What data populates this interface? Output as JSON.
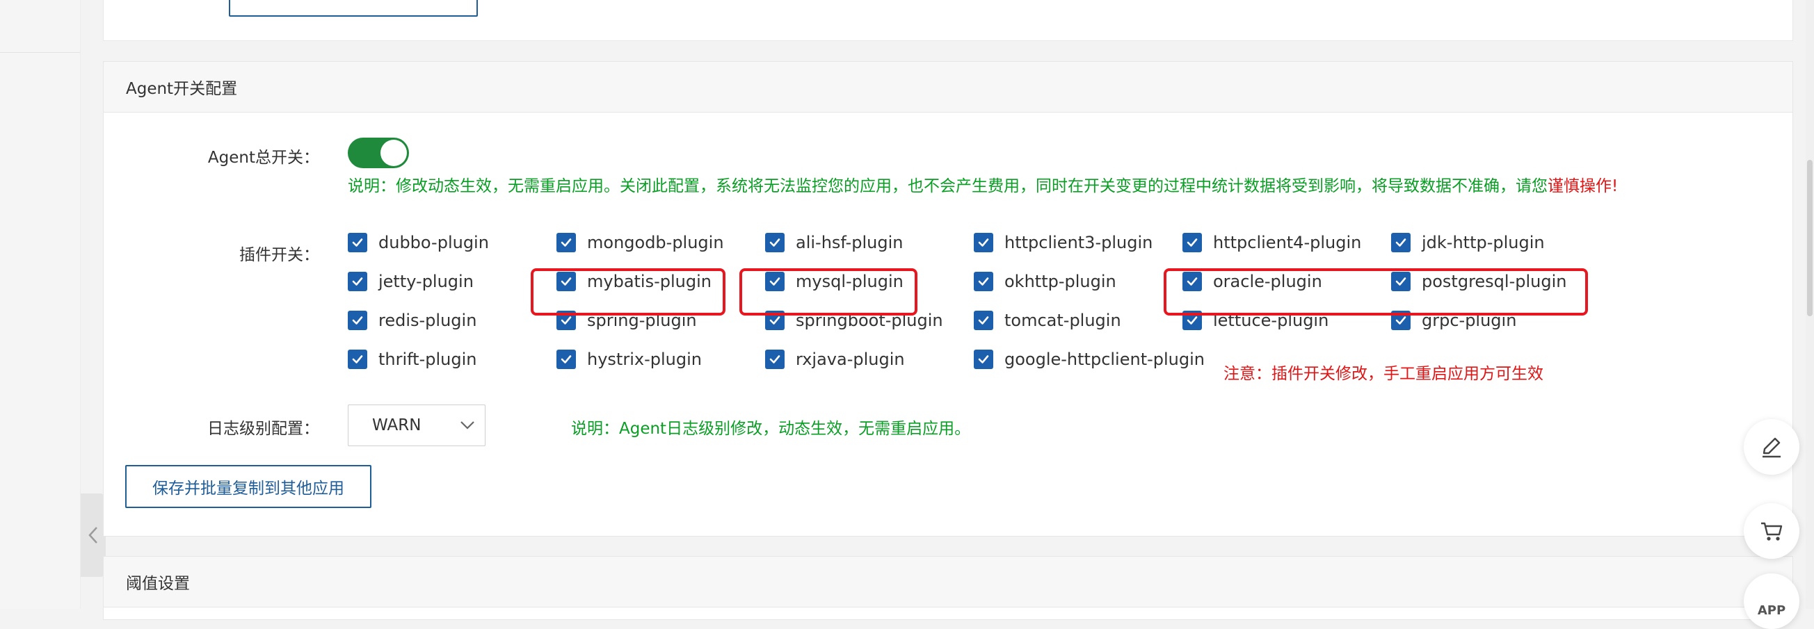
{
  "section": {
    "title": "Agent开关配置"
  },
  "agent_switch": {
    "label": "Agent总开关：",
    "enabled": true,
    "desc": "说明：修改动态生效，无需重启应用。关闭此配置，系统将无法监控您的应用，也不会产生费用，同时在开关变更的过程中统计数据将受到影响，将导致数据不准确，请您",
    "desc_warn": "谨慎操作!"
  },
  "plugins": {
    "label": "插件开关：",
    "items": [
      {
        "label": "dubbo-plugin",
        "checked": true
      },
      {
        "label": "mongodb-plugin",
        "checked": true
      },
      {
        "label": "ali-hsf-plugin",
        "checked": true
      },
      {
        "label": "httpclient3-plugin",
        "checked": true
      },
      {
        "label": "httpclient4-plugin",
        "checked": true
      },
      {
        "label": "jdk-http-plugin",
        "checked": true
      },
      {
        "label": "jetty-plugin",
        "checked": true
      },
      {
        "label": "mybatis-plugin",
        "checked": true
      },
      {
        "label": "mysql-plugin",
        "checked": true
      },
      {
        "label": "okhttp-plugin",
        "checked": true
      },
      {
        "label": "oracle-plugin",
        "checked": true
      },
      {
        "label": "postgresql-plugin",
        "checked": true
      },
      {
        "label": "redis-plugin",
        "checked": true
      },
      {
        "label": "spring-plugin",
        "checked": true
      },
      {
        "label": "springboot-plugin",
        "checked": true
      },
      {
        "label": "tomcat-plugin",
        "checked": true
      },
      {
        "label": "lettuce-plugin",
        "checked": true
      },
      {
        "label": "grpc-plugin",
        "checked": true
      },
      {
        "label": "thrift-plugin",
        "checked": true
      },
      {
        "label": "hystrix-plugin",
        "checked": true
      },
      {
        "label": "rxjava-plugin",
        "checked": true
      },
      {
        "label": "google-httpclient-plugin",
        "checked": true
      }
    ],
    "note": "注意：插件开关修改，手工重启应用方可生效"
  },
  "log_level": {
    "label": "日志级别配置：",
    "value": "WARN",
    "desc": "说明：Agent日志级别修改，动态生效，无需重启应用。"
  },
  "save_button": "保存并批量复制到其他应用",
  "next_section": {
    "title": "阈值设置"
  },
  "floating": {
    "app_label": "APP"
  },
  "colors": {
    "accent": "#1b5fad",
    "toggle_on": "#1f8a3c",
    "green_text": "#0a9e25",
    "red_text": "#e01515",
    "highlight": "#e8161e"
  }
}
